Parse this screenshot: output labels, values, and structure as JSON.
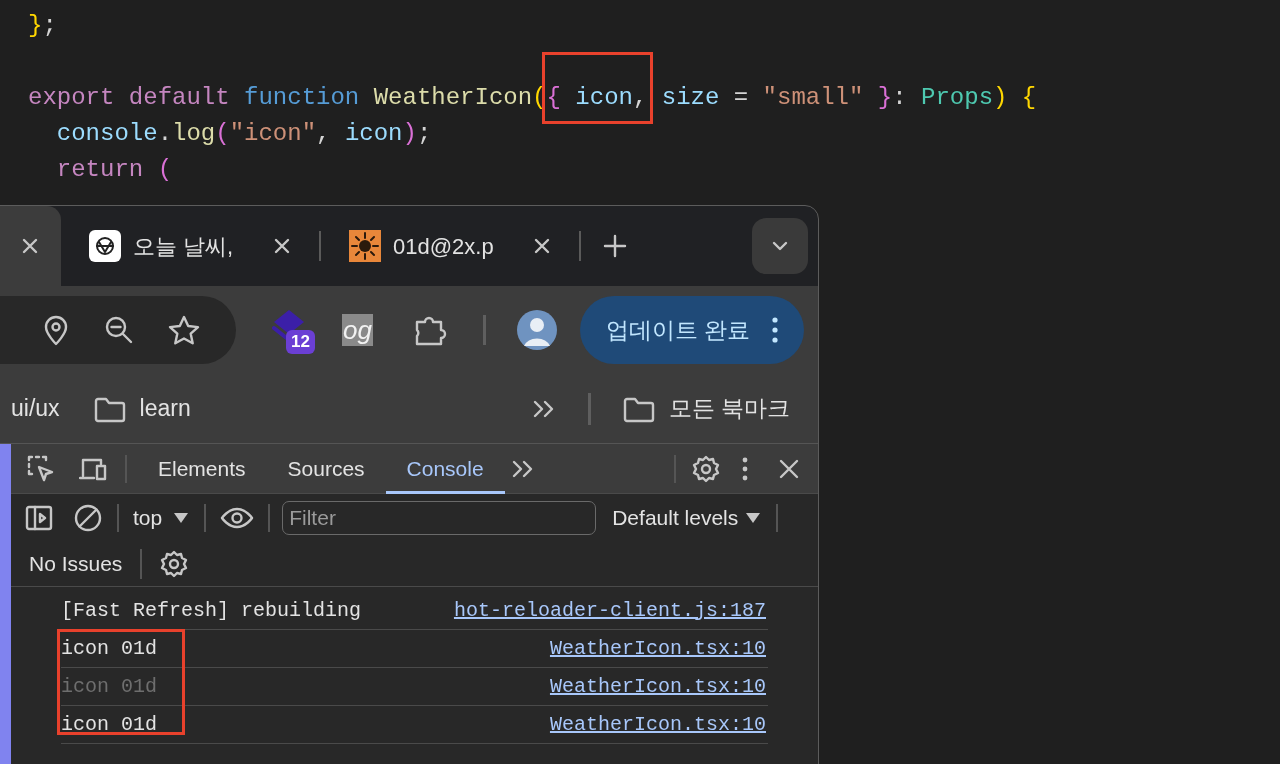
{
  "editor": {
    "blocks": [
      [
        {
          "tokens": [
            {
              "kind": "bracket",
              "text": "}"
            },
            {
              "kind": "plain",
              "text": ";"
            }
          ]
        }
      ],
      [
        {
          "tokens": [
            {
              "kind": "keyword",
              "text": "export "
            },
            {
              "kind": "keyword",
              "text": "default "
            },
            {
              "kind": "storage",
              "text": "function "
            },
            {
              "kind": "function",
              "text": "WeatherIcon"
            },
            {
              "kind": "bracket",
              "text": "("
            },
            {
              "kind": "bracket2",
              "text": "{",
              "boxed": true
            },
            {
              "kind": "variable",
              "text": " icon",
              "boxed": true
            },
            {
              "kind": "plain",
              "text": ",",
              "boxed": true
            },
            {
              "kind": "variable",
              "text": " size"
            },
            {
              "kind": "plain",
              "text": " = "
            },
            {
              "kind": "string",
              "text": "\"small\""
            },
            {
              "kind": "bracket2",
              "text": " }"
            },
            {
              "kind": "plain",
              "text": ": "
            },
            {
              "kind": "type",
              "text": "Props"
            },
            {
              "kind": "bracket",
              "text": ") "
            },
            {
              "kind": "bracket",
              "text": "{"
            }
          ]
        },
        {
          "tokens": [
            {
              "kind": "variable",
              "text": "  console"
            },
            {
              "kind": "plain",
              "text": "."
            },
            {
              "kind": "function",
              "text": "log"
            },
            {
              "kind": "bracket2",
              "text": "("
            },
            {
              "kind": "string",
              "text": "\"icon\""
            },
            {
              "kind": "plain",
              "text": ", "
            },
            {
              "kind": "variable",
              "text": "icon"
            },
            {
              "kind": "bracket2",
              "text": ")"
            },
            {
              "kind": "plain",
              "text": ";"
            }
          ]
        },
        {
          "tokens": [
            {
              "kind": "keyword",
              "text": "  return "
            },
            {
              "kind": "bracket2",
              "text": "("
            }
          ]
        }
      ]
    ]
  },
  "browser": {
    "tabs": [
      {
        "selected": true,
        "kind": "blank"
      },
      {
        "title": "오늘 날씨,",
        "selected": false,
        "kind": "chat"
      },
      {
        "title": "01d@2x.p",
        "selected": false,
        "kind": "image"
      }
    ],
    "extensions_badge": "12",
    "extension_label": "og",
    "update_button": "업데이트 완료",
    "bookmarks": [
      {
        "label": "ui/ux",
        "folder": false
      },
      {
        "label": "learn",
        "folder": true
      }
    ],
    "other_bookmarks": "모든 북마크",
    "devtools": {
      "tabs": [
        {
          "label": "Elements",
          "selected": false
        },
        {
          "label": "Sources",
          "selected": false
        },
        {
          "label": "Console",
          "selected": true
        }
      ],
      "context": "top",
      "filter_placeholder": "Filter",
      "levels": "Default levels",
      "issues": "No Issues",
      "messages": [
        {
          "text": "[Fast Refresh] rebuilding",
          "source": "hot-reloader-client.js:187",
          "dimmed": false,
          "boxed": false
        },
        {
          "text": "icon 01d",
          "source": "WeatherIcon.tsx:10",
          "dimmed": false,
          "boxed": true
        },
        {
          "text": "icon 01d",
          "source": "WeatherIcon.tsx:10",
          "dimmed": true,
          "boxed": true
        },
        {
          "text": "icon 01d",
          "source": "WeatherIcon.tsx:10",
          "dimmed": false,
          "boxed": true
        }
      ]
    }
  }
}
